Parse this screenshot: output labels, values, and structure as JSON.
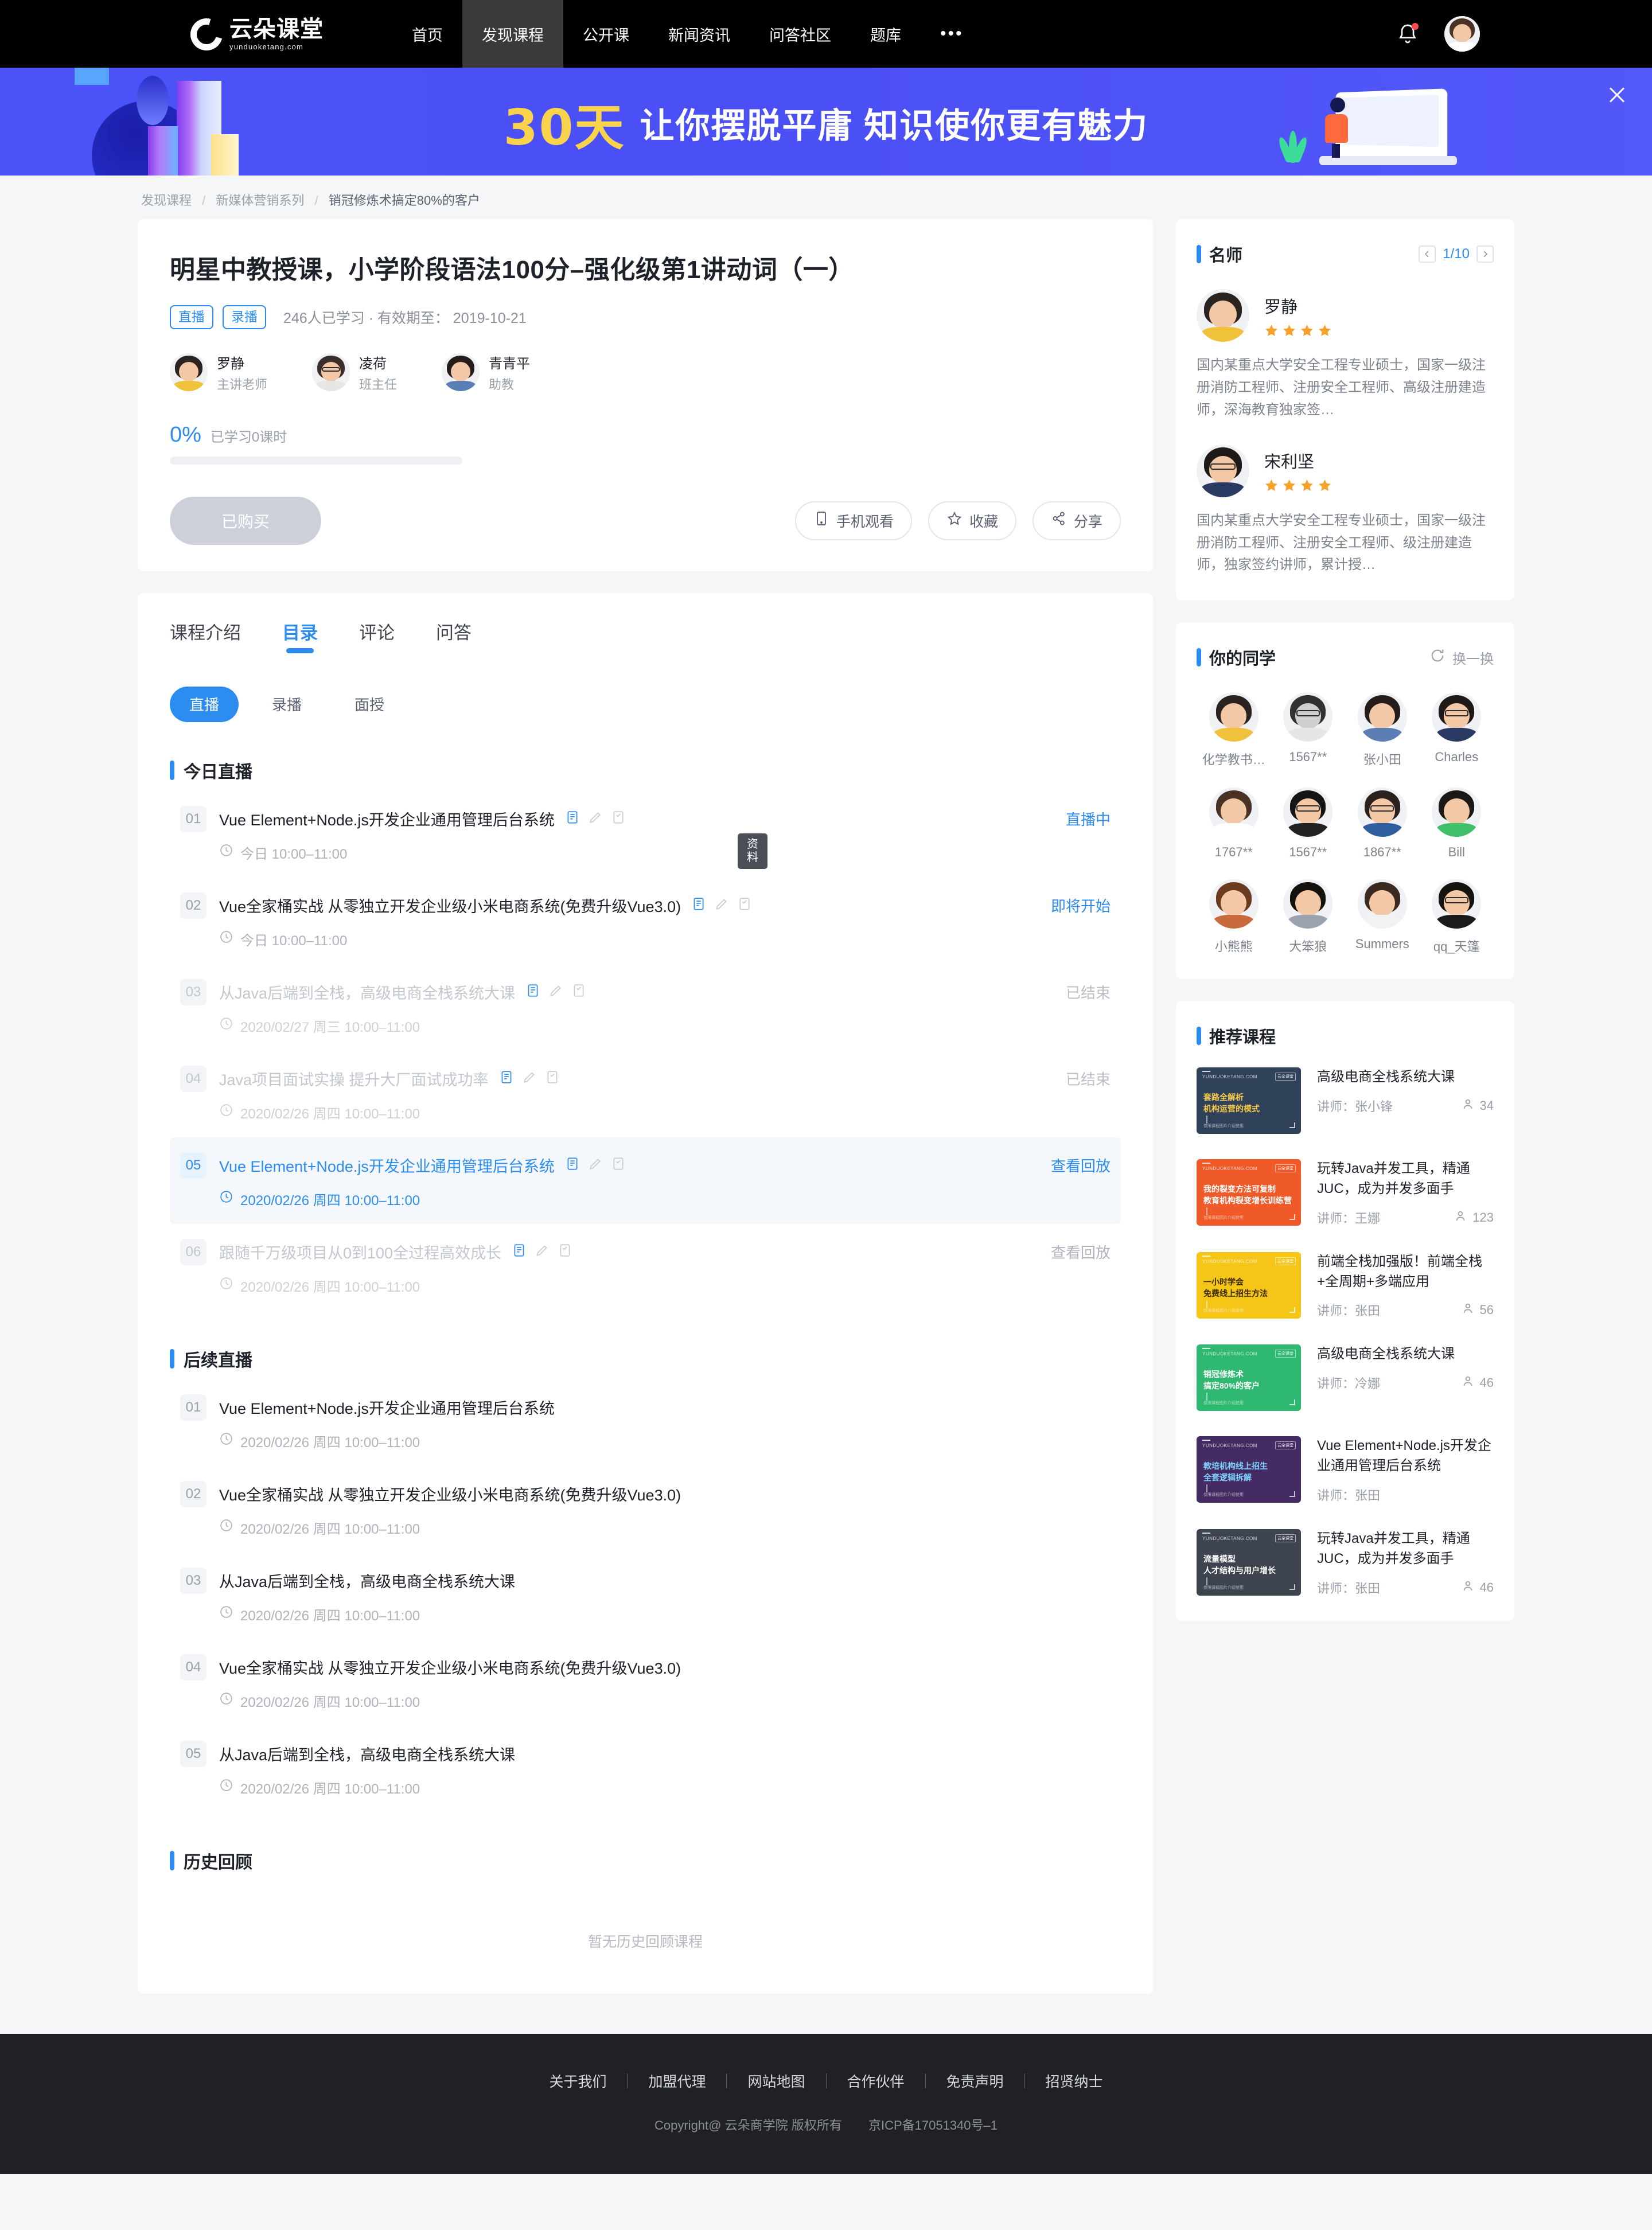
{
  "nav": {
    "logo_cn": "云朵课堂",
    "logo_en": "yunduoketang.com",
    "items": [
      {
        "label": "首页",
        "active": false
      },
      {
        "label": "发现课程",
        "active": true
      },
      {
        "label": "公开课",
        "active": false
      },
      {
        "label": "新闻资讯",
        "active": false
      },
      {
        "label": "问答社区",
        "active": false
      },
      {
        "label": "题库",
        "active": false
      }
    ],
    "more": "•••"
  },
  "banner": {
    "highlight": "30天",
    "text": "让你摆脱平庸  知识使你更有魅力"
  },
  "breadcrumb": [
    "发现课程",
    "新媒体营销系列",
    "销冠修炼术搞定80%的客户"
  ],
  "course": {
    "title": "明星中教授课，小学阶段语法100分–强化级第1讲动词（一）",
    "tags": [
      "直播",
      "录播"
    ],
    "meta": "246人已学习 · 有效期至： 2019-10-21",
    "teachers": [
      {
        "name": "罗静",
        "role": "主讲老师"
      },
      {
        "name": "凌荷",
        "role": "班主任"
      },
      {
        "name": "青青平",
        "role": "助教"
      }
    ],
    "progress_percent": "0%",
    "progress_label": "已学习0课时",
    "buy_button": "已购买",
    "actions": [
      {
        "label": "手机观看",
        "icon": "mobile-icon"
      },
      {
        "label": "收藏",
        "icon": "star-icon"
      },
      {
        "label": "分享",
        "icon": "share-icon"
      }
    ]
  },
  "tabs": [
    {
      "label": "课程介绍",
      "active": false
    },
    {
      "label": "目录",
      "active": true
    },
    {
      "label": "评论",
      "active": false
    },
    {
      "label": "问答",
      "active": false
    }
  ],
  "subtabs": [
    {
      "label": "直播",
      "active": true
    },
    {
      "label": "录播",
      "active": false
    },
    {
      "label": "面授",
      "active": false
    }
  ],
  "tooltip": "资料",
  "sections": {
    "today": {
      "title": "今日直播",
      "lessons": [
        {
          "num": "01",
          "title": "Vue Element+Node.js开发企业通用管理后台系统",
          "time": "今日 10:00–11:00",
          "status": "直播中",
          "status_type": "live",
          "icons": true,
          "state": "normal"
        },
        {
          "num": "02",
          "title": "Vue全家桶实战 从零独立开发企业级小米电商系统(免费升级Vue3.0)",
          "time": "今日 10:00–11:00",
          "status": "即将开始",
          "status_type": "soon",
          "icons": true,
          "state": "normal"
        },
        {
          "num": "03",
          "title": "从Java后端到全栈，高级电商全栈系统大课",
          "time": "2020/02/27 周三 10:00–11:00",
          "status": "已结束",
          "status_type": "ended",
          "icons": true,
          "state": "dim"
        },
        {
          "num": "04",
          "title": "Java项目面试实操 提升大厂面试成功率",
          "time": "2020/02/26 周四 10:00–11:00",
          "status": "已结束",
          "status_type": "ended",
          "icons": true,
          "state": "dim"
        },
        {
          "num": "05",
          "title": "Vue Element+Node.js开发企业通用管理后台系统",
          "time": "2020/02/26 周四 10:00–11:00",
          "status": "查看回放",
          "status_type": "replay-on",
          "icons": true,
          "state": "highlight"
        },
        {
          "num": "06",
          "title": "跟随千万级项目从0到100全过程高效成长",
          "time": "2020/02/26 周四 10:00–11:00",
          "status": "查看回放",
          "status_type": "replay",
          "icons": true,
          "state": "dim"
        }
      ]
    },
    "upcoming": {
      "title": "后续直播",
      "lessons": [
        {
          "num": "01",
          "title": "Vue Element+Node.js开发企业通用管理后台系统",
          "time": "2020/02/26 周四 10:00–11:00",
          "status": "",
          "status_type": "none",
          "icons": false,
          "state": "normal"
        },
        {
          "num": "02",
          "title": "Vue全家桶实战 从零独立开发企业级小米电商系统(免费升级Vue3.0)",
          "time": "2020/02/26 周四 10:00–11:00",
          "status": "",
          "status_type": "none",
          "icons": false,
          "state": "normal"
        },
        {
          "num": "03",
          "title": "从Java后端到全栈，高级电商全栈系统大课",
          "time": "2020/02/26 周四 10:00–11:00",
          "status": "",
          "status_type": "none",
          "icons": false,
          "state": "normal"
        },
        {
          "num": "04",
          "title": "Vue全家桶实战 从零独立开发企业级小米电商系统(免费升级Vue3.0)",
          "time": "2020/02/26 周四 10:00–11:00",
          "status": "",
          "status_type": "none",
          "icons": false,
          "state": "normal"
        },
        {
          "num": "05",
          "title": "从Java后端到全栈，高级电商全栈系统大课",
          "time": "2020/02/26 周四 10:00–11:00",
          "status": "",
          "status_type": "none",
          "icons": false,
          "state": "normal"
        }
      ]
    },
    "history": {
      "title": "历史回顾",
      "empty_text": "暂无历史回顾课程"
    }
  },
  "sidebar": {
    "famous_teachers": {
      "title": "名师",
      "page": "1/10",
      "list": [
        {
          "name": "罗静",
          "stars": 4,
          "desc": "国内某重点大学安全工程专业硕士，国家一级注册消防工程师、注册安全工程师、高级注册建造师，深海教育独家签…"
        },
        {
          "name": "宋利坚",
          "stars": 4,
          "desc": "国内某重点大学安全工程专业硕士，国家一级注册消防工程师、注册安全工程师、级注册建造师，独家签约讲师，累计授…"
        }
      ]
    },
    "classmates": {
      "title": "你的同学",
      "refresh_label": "换一换",
      "list": [
        {
          "name": "化学教书…"
        },
        {
          "name": "1567**"
        },
        {
          "name": "张小田"
        },
        {
          "name": "Charles"
        },
        {
          "name": "1767**"
        },
        {
          "name": "1567**"
        },
        {
          "name": "1867**"
        },
        {
          "name": "Bill"
        },
        {
          "name": "小熊熊"
        },
        {
          "name": "大笨狼"
        },
        {
          "name": "Summers"
        },
        {
          "name": "qq_天篷"
        }
      ]
    },
    "recommended": {
      "title": "推荐课程",
      "list": [
        {
          "title": "高级电商全栈系统大课",
          "teacher": "讲师：张小锋",
          "count": "34",
          "thumb_color": "#2f4259",
          "thumb_l1": "套路全解析",
          "thumb_l2": "机构运营的模式",
          "thumb_text_color": "#f7c948"
        },
        {
          "title": "玩转Java并发工具，精通JUC，成为并发多面手",
          "teacher": "讲师：王娜",
          "count": "123",
          "thumb_color": "#f05a28",
          "thumb_l1": "我的裂变方法可复制",
          "thumb_l2": "教育机构裂变增长训练营",
          "thumb_text_color": "#ffffff"
        },
        {
          "title": "前端全栈加强版！前端全栈+全周期+多端应用",
          "teacher": "讲师：张田",
          "count": "56",
          "thumb_color": "#f5c518",
          "thumb_l1": "一小时学会",
          "thumb_l2": "免费线上招生方法",
          "thumb_text_color": "#3b2a00"
        },
        {
          "title": "高级电商全栈系统大课",
          "teacher": "讲师：冷娜",
          "count": "46",
          "thumb_color": "#2fb872",
          "thumb_l1": "销冠修炼术",
          "thumb_l2": "搞定80%的客户",
          "thumb_text_color": "#ffffff"
        },
        {
          "title": "Vue Element+Node.js开发企业通用管理后台系统",
          "teacher": "讲师：张田",
          "count": "",
          "thumb_color": "#452b63",
          "thumb_l1": "教培机构线上招生",
          "thumb_l2": "全套逻辑拆解",
          "thumb_text_color": "#7fd4ff"
        },
        {
          "title": "玩转Java并发工具，精通JUC，成为并发多面手",
          "teacher": "讲师：张田",
          "count": "46",
          "thumb_color": "#3d4450",
          "thumb_l1": "流量模型",
          "thumb_l2": "人才结构与用户增长",
          "thumb_text_color": "#ffffff"
        }
      ],
      "thumb_brand": "YUNDUOKETANG.COM",
      "thumb_badge": "云朵课堂",
      "thumb_foot": "仅限课程图片介绍使用"
    }
  },
  "footer": {
    "links": [
      "关于我们",
      "加盟代理",
      "网站地图",
      "合作伙伴",
      "免责声明",
      "招贤纳士"
    ],
    "copyright": "Copyright@ 云朵商学院   版权所有",
    "icp": "京ICP备17051340号–1"
  },
  "colors": {
    "accent": "#2d8cf0",
    "banner_bg": "#4b53f7",
    "banner_highlight": "#f9d34b",
    "star": "#f7a22b",
    "footer_bg": "#1f2125"
  }
}
